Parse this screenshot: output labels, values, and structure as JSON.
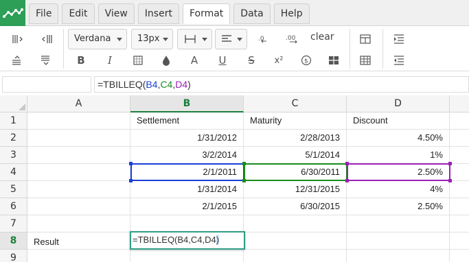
{
  "menu": {
    "items": [
      "File",
      "Edit",
      "View",
      "Insert",
      "Format",
      "Data",
      "Help"
    ],
    "active": "Format"
  },
  "toolbar": {
    "font_family": "Verdana",
    "font_size": "13px",
    "clear_label": "clear",
    "bold_label": "B",
    "italic_label": "I",
    "text_color_label": "A",
    "underline_label": "U",
    "strike_label": "S",
    "superscript_label": "x²"
  },
  "formula_bar": {
    "name_box": "",
    "formula_prefix": "=TBILLEQ(",
    "arg1": "B4",
    "comma1": ",",
    "arg2": "C4",
    "comma2": ",",
    "arg3": "D4",
    "formula_suffix": ")"
  },
  "grid": {
    "columns": [
      "A",
      "B",
      "C",
      "D"
    ],
    "selected_column": "B",
    "rows": [
      "1",
      "2",
      "3",
      "4",
      "5",
      "6",
      "7",
      "8",
      "9"
    ],
    "selected_row": "8",
    "cells": {
      "B1": "Settlement",
      "C1": "Maturity",
      "D1": "Discount",
      "B2": "1/31/2012",
      "C2": "2/28/2013",
      "D2": "4.50%",
      "B3": "3/2/2014",
      "C3": "5/1/2014",
      "D3": "1%",
      "B4": "2/1/2011",
      "C4": "6/30/2011",
      "D4": "2.50%",
      "B5": "1/31/2014",
      "C5": "12/31/2015",
      "D5": "4%",
      "B6": "2/1/2015",
      "C6": "6/30/2015",
      "D6": "2.50%",
      "A8": "Result"
    },
    "editing_cell": {
      "ref": "B8",
      "text_main": "=TBILLEQ(B4,C4,D4",
      "text_paren": ")"
    }
  },
  "colors": {
    "accent_green": "#1a7f3c",
    "ref_blue": "#1a3fd6",
    "ref_green": "#1a8c1a",
    "ref_purple": "#9b1fb5",
    "edit_border": "#2e9e86"
  }
}
